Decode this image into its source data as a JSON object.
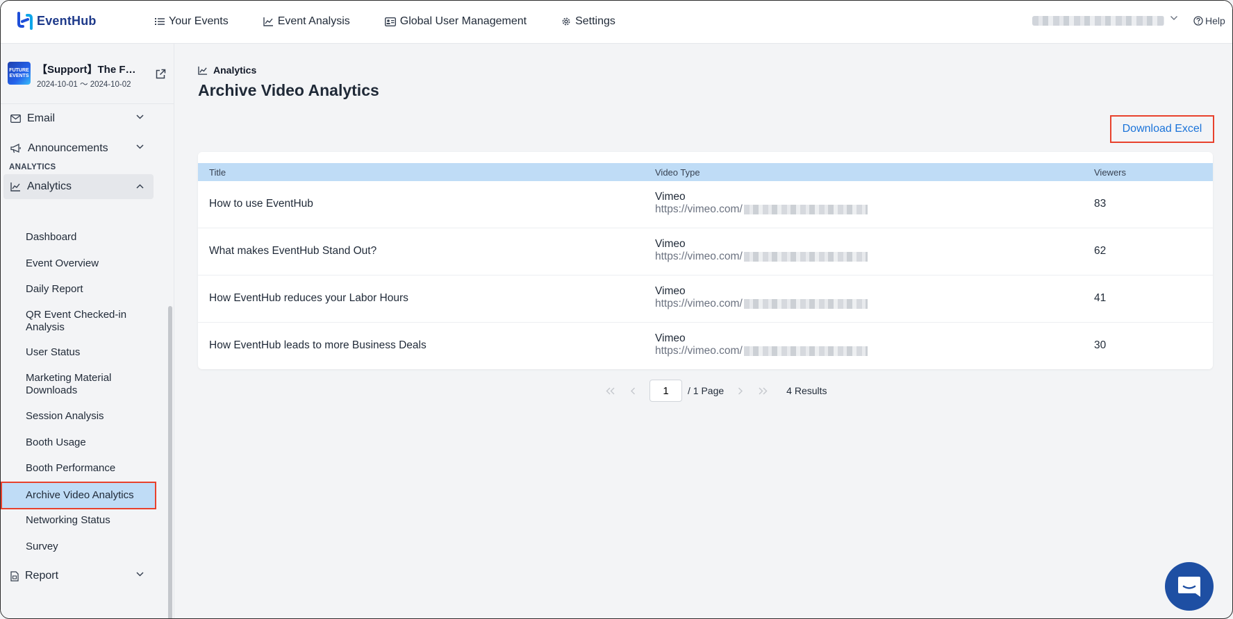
{
  "app": {
    "name": "EventHub"
  },
  "nav": [
    {
      "label": "Your Events",
      "icon": "list-icon"
    },
    {
      "label": "Event Analysis",
      "icon": "chart-line-icon"
    },
    {
      "label": "Global User Management",
      "icon": "id-card-icon"
    },
    {
      "label": "Settings",
      "icon": "gear-icon"
    }
  ],
  "header": {
    "help": "Help"
  },
  "event": {
    "name": "【Support】The F…",
    "dates": "2024-10-01 ～ 2024-10-02",
    "thumb_text": "FUTURE EVENTS"
  },
  "sidebar": {
    "email": "Email",
    "announcements": "Announcements",
    "section_analytics": "ANALYTICS",
    "analytics": "Analytics",
    "sub_items": [
      "Dashboard",
      "Event Overview",
      "Daily Report",
      "QR Event Checked-in Analysis",
      "User Status",
      "Marketing Material Downloads",
      "Session Analysis",
      "Booth Usage",
      "Booth Performance",
      "Archive Video Analytics",
      "Networking Status",
      "Survey"
    ],
    "report": "Report"
  },
  "main": {
    "breadcrumb": "Analytics",
    "title": "Archive Video Analytics",
    "download_label": "Download Excel",
    "columns": [
      "Title",
      "Video Type",
      "Viewers"
    ],
    "rows": [
      {
        "title": "How to use EventHub",
        "type": "Vimeo",
        "url": "https://vimeo.com/",
        "viewers": "83"
      },
      {
        "title": "What makes EventHub Stand Out?",
        "type": "Vimeo",
        "url": "https://vimeo.com/",
        "viewers": "62"
      },
      {
        "title": "How EventHub reduces your Labor Hours",
        "type": "Vimeo",
        "url": "https://vimeo.com/",
        "viewers": "41"
      },
      {
        "title": "How EventHub leads to more Business Deals",
        "type": "Vimeo",
        "url": "https://vimeo.com/",
        "viewers": "30"
      }
    ]
  },
  "pagination": {
    "current_page": "1",
    "page_total": "/ 1 Page",
    "results": "4 Results"
  },
  "colors": {
    "accent": "#1a73d9",
    "highlight": "#e8412c",
    "row_header": "#bfdcf6",
    "brand": "#1e3a8a"
  }
}
